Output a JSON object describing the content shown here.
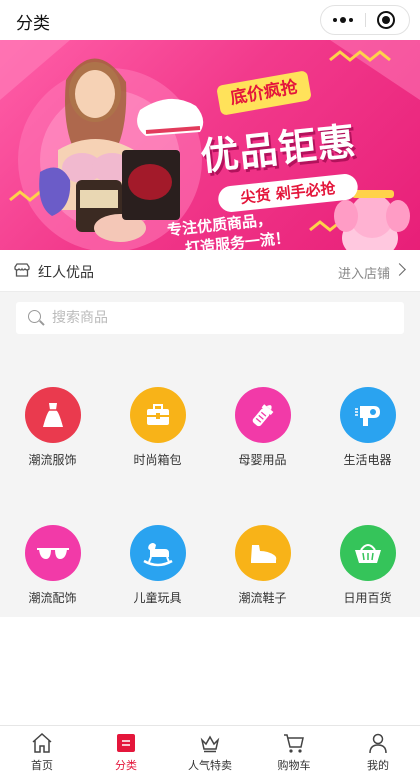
{
  "topbar": {
    "title": "分类"
  },
  "banner": {
    "tag": "底价疯抢",
    "headline": "优品钜惠",
    "sub": "尖货 剁手必抢",
    "slogan_line1": "专注优质商品，",
    "slogan_line2": "打造服务一流！"
  },
  "shop": {
    "name": "红人优品",
    "enter_label": "进入店铺"
  },
  "search": {
    "placeholder": "搜索商品"
  },
  "categories": [
    {
      "label": "潮流服饰",
      "icon": "dress-icon",
      "color": "#ea3a4e"
    },
    {
      "label": "时尚箱包",
      "icon": "bag-icon",
      "color": "#f8b318"
    },
    {
      "label": "母婴用品",
      "icon": "baby-bottle-icon",
      "color": "#f23aa8"
    },
    {
      "label": "生活电器",
      "icon": "hair-dryer-icon",
      "color": "#2aa3f0"
    },
    {
      "label": "潮流配饰",
      "icon": "sunglasses-icon",
      "color": "#f23aa8"
    },
    {
      "label": "儿童玩具",
      "icon": "rocking-horse-icon",
      "color": "#2aa3f0"
    },
    {
      "label": "潮流鞋子",
      "icon": "shoe-icon",
      "color": "#f8b318"
    },
    {
      "label": "日用百货",
      "icon": "basket-icon",
      "color": "#35c45a"
    }
  ],
  "tabbar": [
    {
      "label": "首页",
      "icon": "home-icon",
      "active": false
    },
    {
      "label": "分类",
      "icon": "category-icon",
      "active": true
    },
    {
      "label": "人气特卖",
      "icon": "crown-icon",
      "active": false
    },
    {
      "label": "购物车",
      "icon": "cart-icon",
      "active": false
    },
    {
      "label": "我的",
      "icon": "user-icon",
      "active": false
    }
  ],
  "colors": {
    "accent": "#e4163b",
    "banner_pink": "#f23a8c"
  }
}
